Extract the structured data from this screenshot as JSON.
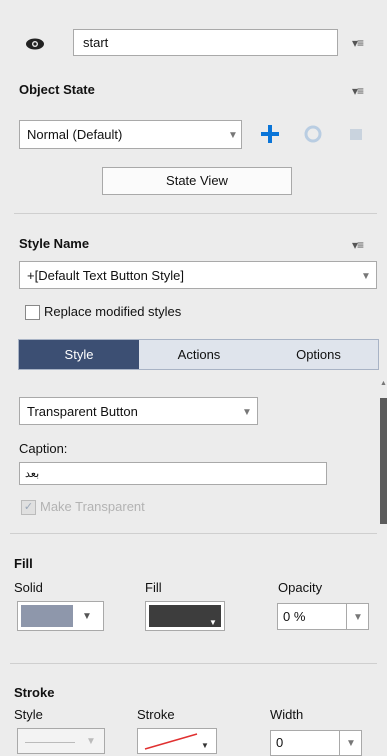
{
  "header": {
    "name_value": "start"
  },
  "object_state": {
    "title": "Object State",
    "state_selected": "Normal (Default)",
    "state_view_label": "State View"
  },
  "style_name": {
    "title": "Style Name",
    "selected": "+[Default Text Button Style]",
    "replace_modified_label": "Replace modified styles"
  },
  "tabs": {
    "style": "Style",
    "actions": "Actions",
    "options": "Options"
  },
  "style_panel": {
    "button_type": "Transparent Button",
    "caption_label": "Caption:",
    "caption_value": "ﺑﻌﺪ",
    "make_transparent_label": "Make Transparent"
  },
  "fill": {
    "title": "Fill",
    "solid_label": "Solid",
    "fill_label": "Fill",
    "opacity_label": "Opacity",
    "opacity_value": "0 %",
    "solid_color": "#8e97ab",
    "fill_color": "#3d3d3d"
  },
  "stroke": {
    "title": "Stroke",
    "style_label": "Style",
    "stroke_label": "Stroke",
    "width_label": "Width",
    "width_value": "0"
  },
  "colors": {
    "accent": "#0a75d8",
    "tab_active_bg": "#3c4f73"
  }
}
